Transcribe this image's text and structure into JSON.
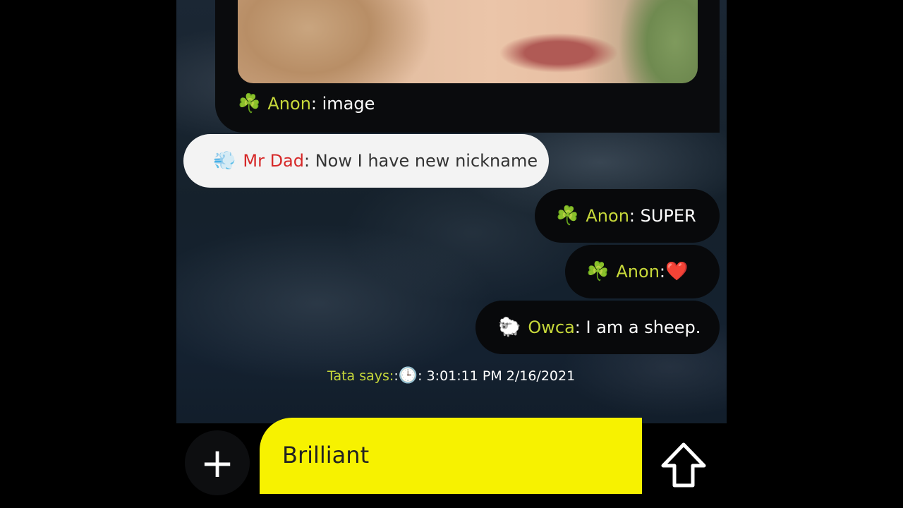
{
  "messages": {
    "photo": {
      "emoji": "☘️",
      "name": "Anon",
      "text": ": image"
    },
    "m1": {
      "emoji": "💨",
      "name": "Mr Dad",
      "text": ": Now I have new nickname"
    },
    "m2": {
      "emoji": "☘️",
      "name": "Anon",
      "text": ": SUPER"
    },
    "m3": {
      "emoji": "☘️",
      "name": "Anon",
      "text": ": ",
      "heart": "❤️"
    },
    "m4": {
      "emoji": "🐑",
      "name": "Owca",
      "text": ": I am a sheep."
    }
  },
  "status": {
    "label": "Tata says:",
    "sep": " : ",
    "clock": "🕒",
    "time": ": 3:01:11 PM 2/16/2021"
  },
  "composer": {
    "add_label": "+",
    "input_value": "Brilliant"
  },
  "colors": {
    "accent_yellow": "#f7f200",
    "name_yellow": "#c7d83a",
    "name_red": "#d62828"
  },
  "icons": {
    "send": "arrow-up-outline-icon",
    "add": "plus-icon"
  }
}
